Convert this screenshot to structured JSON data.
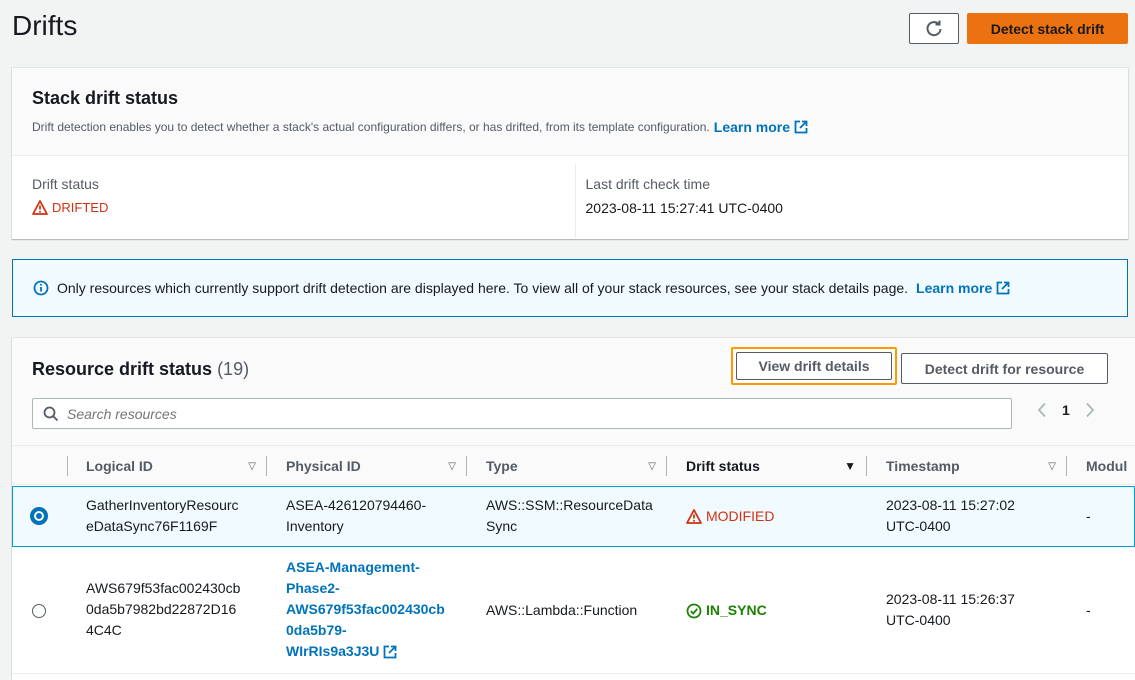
{
  "page": {
    "title": "Drifts",
    "detect_stack_drift": "Detect stack drift"
  },
  "stack_status": {
    "title": "Stack drift status",
    "description": "Drift detection enables you to detect whether a stack's actual configuration differs, or has drifted, from its template configuration.",
    "learn_more": "Learn more",
    "drift_status_label": "Drift status",
    "drift_status_value": "DRIFTED",
    "last_check_label": "Last drift check time",
    "last_check_value": "2023-08-11 15:27:41 UTC-0400"
  },
  "info": {
    "text": "Only resources which currently support drift detection are displayed here. To view all of your stack resources, see your stack details page.",
    "learn_more": "Learn more"
  },
  "resources": {
    "title": "Resource drift status",
    "count": "(19)",
    "view_details": "View drift details",
    "detect_resource": "Detect drift for resource",
    "search_placeholder": "Search resources",
    "page_number": "1",
    "columns": [
      "Logical ID",
      "Physical ID",
      "Type",
      "Drift status",
      "Timestamp",
      "Modul"
    ],
    "rows": [
      {
        "logical_id_l1": "GatherInventoryResourc",
        "logical_id_l2": "eDataSync76F1169F",
        "physical_id_l1": "ASEA-426120794460-",
        "physical_id_l2": "Inventory",
        "type_l1": "AWS::SSM::ResourceData",
        "type_l2": "Sync",
        "drift_status": "MODIFIED",
        "timestamp_l1": "2023-08-11 15:27:02",
        "timestamp_l2": "UTC-0400",
        "module": "-"
      },
      {
        "logical_id_l1": "AWS679f53fac002430cb",
        "logical_id_l2": "0da5b7982bd22872D16",
        "logical_id_l3": "4C4C",
        "physical_id_l1": "ASEA-Management-",
        "physical_id_l2": "Phase2-",
        "physical_id_l3": "AWS679f53fac002430cb",
        "physical_id_l4": "0da5b79-",
        "physical_id_l5": "WIrRIs9a3J3U",
        "type_l1": "AWS::Lambda::Function",
        "drift_status": "IN_SYNC",
        "timestamp_l1": "2023-08-11 15:26:37",
        "timestamp_l2": "UTC-0400",
        "module": "-"
      }
    ]
  }
}
